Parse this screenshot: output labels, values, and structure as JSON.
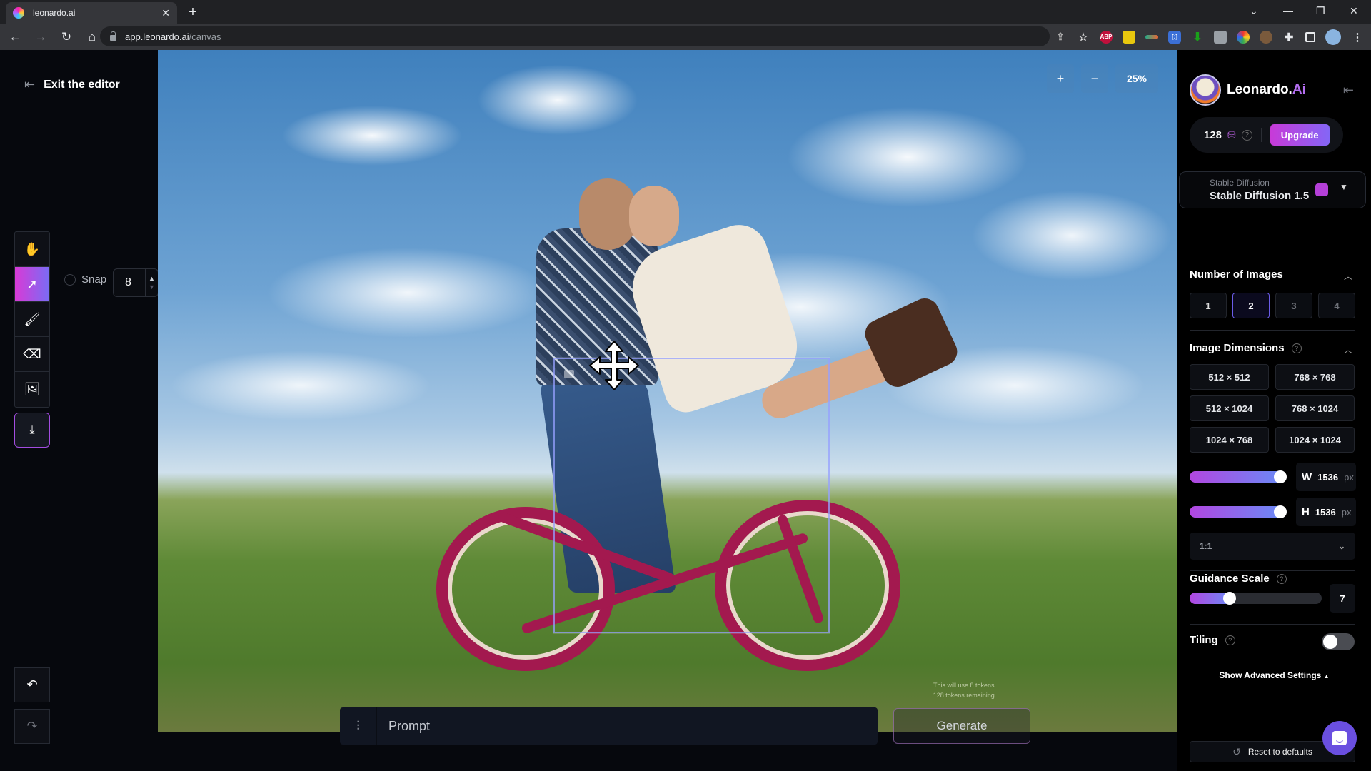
{
  "browser": {
    "tab_title": "leonardo.ai",
    "url_domain": "app.leonardo.ai",
    "url_path": "/canvas",
    "extensions": [
      "share-icon",
      "star-icon",
      "adblock-plus",
      "yellow-extension",
      "bird-extension",
      "bracket-extension",
      "download-arrow-extension",
      "camera-extension",
      "color-wheel-extension",
      "cookie-extension",
      "puzzle-icon",
      "sidebar-icon",
      "profile-avatar",
      "menu-dots-icon"
    ],
    "adblock_label": "ABP"
  },
  "editor": {
    "exit_label": "Exit the editor",
    "tools": [
      {
        "name": "pan-tool",
        "icon": "hand-icon",
        "glyph": "✋",
        "active": false
      },
      {
        "name": "select-tool",
        "icon": "cursor-sparkle-icon",
        "glyph": "➚",
        "active": true
      },
      {
        "name": "paint-tool",
        "icon": "brush-icon",
        "glyph": "🖌",
        "active": false
      },
      {
        "name": "erase-tool",
        "icon": "eraser-icon",
        "glyph": "⌫",
        "active": false
      },
      {
        "name": "image-tool",
        "icon": "image-icon",
        "glyph": "🖼",
        "active": false
      }
    ],
    "download_glyph": "⤓",
    "snap_label": "Snap",
    "snap_value": "8",
    "undo_glyph": "↶",
    "redo_glyph": "↷"
  },
  "canvas": {
    "zoom_in": "+",
    "zoom_out": "−",
    "zoom_level": "25%",
    "prompt_placeholder": "Prompt",
    "generate_label": "Generate",
    "token_note_line1": "This will use 8 tokens.",
    "token_note_line2": "128 tokens remaining."
  },
  "panel": {
    "brand_name": "Leonardo.",
    "brand_suffix": "Ai",
    "credits": "128",
    "upgrade_label": "Upgrade",
    "model_category": "Stable Diffusion",
    "model_name": "Stable Diffusion 1.5",
    "num_images_title": "Number of Images",
    "num_images_options": [
      "1",
      "2",
      "3",
      "4"
    ],
    "num_images_selected": "2",
    "dimensions_title": "Image Dimensions",
    "dimension_presets": [
      "512 × 512",
      "768 × 768",
      "512 × 1024",
      "768 × 1024",
      "1024 × 768",
      "1024 × 1024"
    ],
    "width_label": "W",
    "width_value": "1536",
    "height_label": "H",
    "height_value": "1536",
    "unit": "px",
    "width_slider_fraction": 1.0,
    "height_slider_fraction": 1.0,
    "aspect_ratio": "1:1",
    "guidance_title": "Guidance Scale",
    "guidance_value": "7",
    "guidance_slider_fraction": 0.3,
    "tiling_title": "Tiling",
    "tiling_on": false,
    "advanced_label": "Show Advanced Settings",
    "reset_label": "Reset to defaults"
  }
}
